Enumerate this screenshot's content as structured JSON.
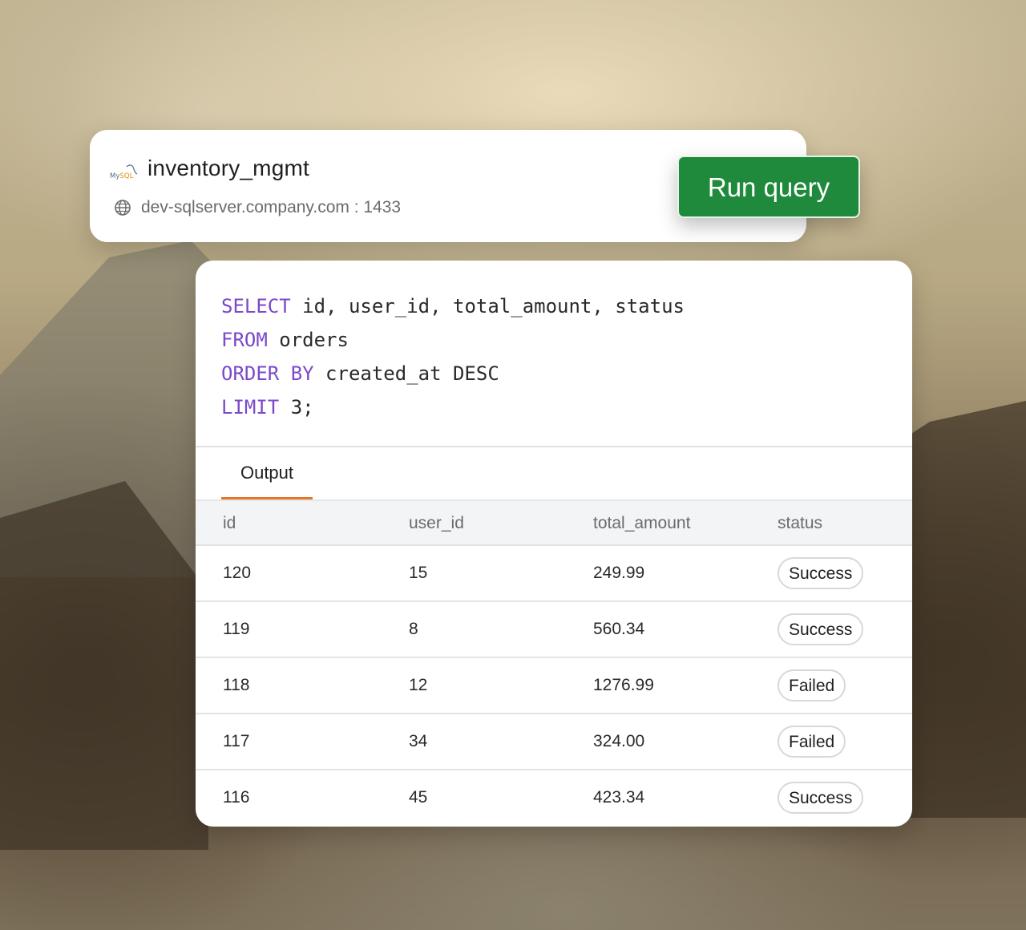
{
  "connection": {
    "db_logo_icon": "mysql-logo",
    "db_logo_text": "MySQL",
    "database_name": "inventory_mgmt",
    "host_icon": "globe-icon",
    "host": "dev-sqlserver.company.com : 1433"
  },
  "toolbar": {
    "run_label": "Run query"
  },
  "query": {
    "lines": [
      {
        "keyword": "SELECT",
        "rest": " id, user_id, total_amount, status"
      },
      {
        "keyword": "FROM",
        "rest": " orders"
      },
      {
        "keyword": "ORDER BY",
        "rest": " created_at DESC"
      },
      {
        "keyword": "LIMIT",
        "rest": " 3;"
      }
    ]
  },
  "tabs": {
    "output_label": "Output"
  },
  "table": {
    "columns": [
      "id",
      "user_id",
      "total_amount",
      "status"
    ],
    "rows": [
      {
        "id": "120",
        "user_id": "15",
        "total_amount": "249.99",
        "status": "Success"
      },
      {
        "id": "119",
        "user_id": "8",
        "total_amount": "560.34",
        "status": "Success"
      },
      {
        "id": "118",
        "user_id": "12",
        "total_amount": "1276.99",
        "status": "Failed"
      },
      {
        "id": "117",
        "user_id": "34",
        "total_amount": "324.00",
        "status": "Failed"
      },
      {
        "id": "116",
        "user_id": "45",
        "total_amount": "423.34",
        "status": "Success"
      }
    ]
  },
  "colors": {
    "run_button": "#1f8a3c",
    "keyword": "#7b49c9",
    "tab_accent": "#e8742a"
  }
}
